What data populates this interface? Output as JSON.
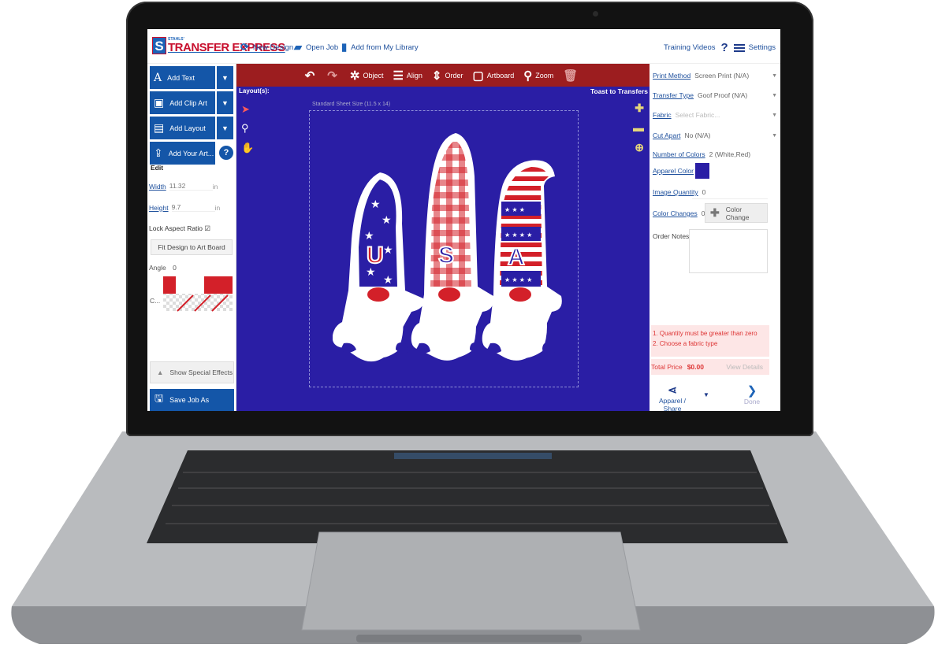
{
  "header": {
    "logo_small": "STAHLS'",
    "logo_text": "TRANSFER EXPRESS",
    "new_design": "New Design",
    "open_job": "Open Job",
    "add_from_library": "Add from My Library",
    "training_videos": "Training Videos",
    "help_glyph": "?",
    "settings": "Settings"
  },
  "left": {
    "add_text": "Add Text",
    "add_clip_art": "Add Clip Art",
    "add_layout": "Add Layout",
    "add_your_art": "Add Your Art...",
    "edit": "Edit",
    "width_label": "Width",
    "width_value": "11.32",
    "width_unit": "in",
    "height_label": "Height",
    "height_value": "9.7",
    "height_unit": "in",
    "lock_aspect": "Lock Aspect Ratio",
    "fit_design": "Fit Design to Art Board",
    "angle_label": "Angle",
    "angle_value": "0",
    "color_label": "C...",
    "show_special": "Show Special Effects",
    "save_job": "Save Job As"
  },
  "toolbar": {
    "object": "Object",
    "align": "Align",
    "order": "Order",
    "artboard": "Artboard",
    "zoom": "Zoom"
  },
  "canvas": {
    "layouts": "Layout(s):",
    "toast": "Toast to Transfers",
    "sheet_size": "Standard Sheet Size (11.5 x 14)",
    "letters": [
      "U",
      "S",
      "A"
    ],
    "bg_color": "#2a1ea5"
  },
  "right": {
    "print_method_label": "Print Method",
    "print_method_value": "Screen Print (N/A)",
    "transfer_type_label": "Transfer Type",
    "transfer_type_value": "Goof Proof (N/A)",
    "fabric_label": "Fabric",
    "fabric_placeholder": "Select Fabric...",
    "cut_apart_label": "Cut Apart",
    "cut_apart_value": "No (N/A)",
    "num_colors_label": "Number of Colors",
    "num_colors_value": "2 (White,Red)",
    "apparel_color_label": "Apparel Color",
    "image_qty_label": "Image Quantity",
    "image_qty_value": "0",
    "color_changes_label": "Color Changes",
    "color_changes_value": "0",
    "color_change_btn": "Color Change",
    "order_notes": "Order Notes",
    "error_1": "1. Quantity must be greater than zero",
    "error_2": "2. Choose a fabric type",
    "total_price_label": "Total Price",
    "total_price_value": "$0.00",
    "view_details": "View Details",
    "apparel_share": "Apparel / Share",
    "done": "Done"
  },
  "colors": {
    "brand_blue": "#1456a8",
    "toolbar_red": "#9c1d1f",
    "gnome_red": "#d32029",
    "gnome_blue": "#2a1ea5"
  }
}
